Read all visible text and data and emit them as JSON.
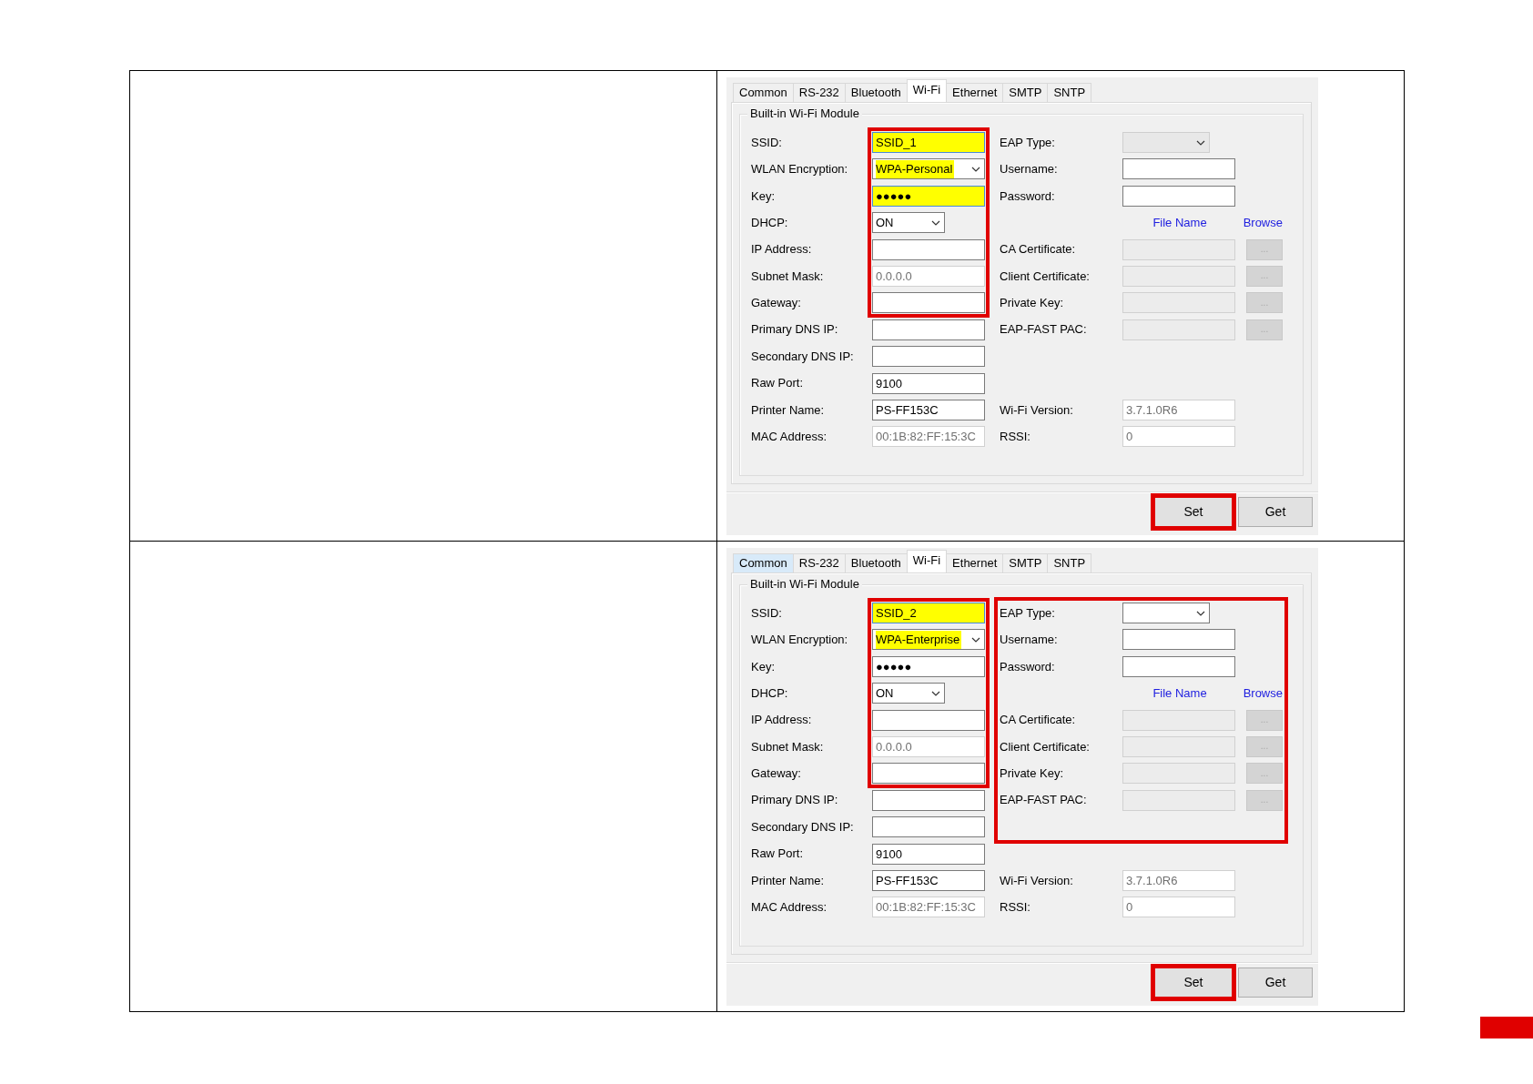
{
  "panels": [
    {
      "tabs": [
        {
          "label": "Common",
          "selected": false,
          "hovered": false
        },
        {
          "label": "RS-232",
          "selected": false,
          "hovered": false
        },
        {
          "label": "Bluetooth",
          "selected": false,
          "hovered": false
        },
        {
          "label": "Wi-Fi",
          "selected": true,
          "hovered": false
        },
        {
          "label": "Ethernet",
          "selected": false,
          "hovered": false
        },
        {
          "label": "SMTP",
          "selected": false,
          "hovered": false
        },
        {
          "label": "SNTP",
          "selected": false,
          "hovered": false
        }
      ],
      "group_title": "Built-in Wi-Fi Module",
      "fields": [
        {
          "label": "SSID:",
          "kind": "text",
          "value": "SSID_1",
          "highlighted": true,
          "disabled": false
        },
        {
          "label": "WLAN Encryption:",
          "kind": "select",
          "value": "WPA-Personal",
          "highlighted": true,
          "disabled": false
        },
        {
          "label": "Key:",
          "kind": "text",
          "value": "●●●●●",
          "highlighted": true,
          "disabled": false
        },
        {
          "label": "DHCP:",
          "kind": "compact",
          "value": "ON",
          "highlighted": false,
          "disabled": false
        },
        {
          "label": "IP Address:",
          "kind": "text",
          "highlighted": false,
          "disabled": false
        },
        {
          "label": "Subnet Mask:",
          "kind": "text",
          "value": "0.0.0.0",
          "highlighted": false,
          "disabled": true
        },
        {
          "label": "Gateway:",
          "kind": "text",
          "highlighted": false,
          "disabled": false
        },
        {
          "label": "Primary DNS IP:",
          "kind": "text",
          "highlighted": false,
          "disabled": false
        },
        {
          "label": "Secondary DNS IP:",
          "kind": "text",
          "highlighted": false,
          "disabled": false
        },
        {
          "label": "Raw Port:",
          "kind": "text",
          "value": "9100",
          "highlighted": false,
          "disabled": false
        },
        {
          "label": "Printer Name:",
          "kind": "text",
          "value": "PS-FF153C",
          "highlighted": false,
          "disabled": false
        },
        {
          "label": "MAC Address:",
          "kind": "text",
          "value": "00:1B:82:FF:15:3C",
          "highlighted": false,
          "disabled": true
        }
      ],
      "right_rows": [
        {
          "kind": "select",
          "label": "EAP Type:",
          "disabled": true
        },
        {
          "kind": "text",
          "label": "Username:",
          "disabled": false
        },
        {
          "kind": "text",
          "label": "Password:",
          "disabled": false
        },
        {
          "kind": "header",
          "file_column": "File Name",
          "browse_column": "Browse"
        },
        {
          "kind": "file",
          "label": "CA Certificate:",
          "button": "...",
          "disabled": true
        },
        {
          "kind": "file",
          "label": "Client Certificate:",
          "button": "...",
          "disabled": true
        },
        {
          "kind": "file",
          "label": "Private Key:",
          "button": "...",
          "disabled": true
        },
        {
          "kind": "file",
          "label": "EAP-FAST PAC:",
          "button": "...",
          "disabled": true
        }
      ],
      "info_rows": [
        {
          "label": "Wi-Fi Version:",
          "value": "3.7.1.0R6",
          "disabled": true
        },
        {
          "label": "RSSI:",
          "value": "0",
          "disabled": true
        }
      ],
      "buttons": [
        {
          "label": "Set",
          "outlined": true
        },
        {
          "label": "Get",
          "outlined": false
        }
      ],
      "network_frame": true,
      "eap_frame": false
    },
    {
      "tabs": [
        {
          "label": "Common",
          "selected": false,
          "hovered": true
        },
        {
          "label": "RS-232",
          "selected": false,
          "hovered": false
        },
        {
          "label": "Bluetooth",
          "selected": false,
          "hovered": false
        },
        {
          "label": "Wi-Fi",
          "selected": true,
          "hovered": false
        },
        {
          "label": "Ethernet",
          "selected": false,
          "hovered": false
        },
        {
          "label": "SMTP",
          "selected": false,
          "hovered": false
        },
        {
          "label": "SNTP",
          "selected": false,
          "hovered": false
        }
      ],
      "group_title": "Built-in Wi-Fi Module",
      "fields": [
        {
          "label": "SSID:",
          "kind": "text",
          "value": "SSID_2",
          "highlighted": true,
          "disabled": false
        },
        {
          "label": "WLAN Encryption:",
          "kind": "select",
          "value": "WPA-Enterprise",
          "highlighted": true,
          "disabled": false
        },
        {
          "label": "Key:",
          "kind": "text",
          "value": "●●●●●",
          "highlighted": false,
          "disabled": false
        },
        {
          "label": "DHCP:",
          "kind": "compact",
          "value": "ON",
          "highlighted": false,
          "disabled": false
        },
        {
          "label": "IP Address:",
          "kind": "text",
          "highlighted": false,
          "disabled": false
        },
        {
          "label": "Subnet Mask:",
          "kind": "text",
          "value": "0.0.0.0",
          "highlighted": false,
          "disabled": true
        },
        {
          "label": "Gateway:",
          "kind": "text",
          "highlighted": false,
          "disabled": false
        },
        {
          "label": "Primary DNS IP:",
          "kind": "text",
          "highlighted": false,
          "disabled": false
        },
        {
          "label": "Secondary DNS IP:",
          "kind": "text",
          "highlighted": false,
          "disabled": false
        },
        {
          "label": "Raw Port:",
          "kind": "text",
          "value": "9100",
          "highlighted": false,
          "disabled": false
        },
        {
          "label": "Printer Name:",
          "kind": "text",
          "value": "PS-FF153C",
          "highlighted": false,
          "disabled": false
        },
        {
          "label": "MAC Address:",
          "kind": "text",
          "value": "00:1B:82:FF:15:3C",
          "highlighted": false,
          "disabled": true
        }
      ],
      "right_rows": [
        {
          "kind": "select",
          "label": "EAP Type:",
          "disabled": false
        },
        {
          "kind": "text",
          "label": "Username:",
          "disabled": false
        },
        {
          "kind": "text",
          "label": "Password:",
          "disabled": false
        },
        {
          "kind": "header",
          "file_column": "File Name",
          "browse_column": "Browse"
        },
        {
          "kind": "file",
          "label": "CA Certificate:",
          "button": "...",
          "disabled": true
        },
        {
          "kind": "file",
          "label": "Client Certificate:",
          "button": "...",
          "disabled": true
        },
        {
          "kind": "file",
          "label": "Private Key:",
          "button": "...",
          "disabled": true
        },
        {
          "kind": "file",
          "label": "EAP-FAST PAC:",
          "button": "...",
          "disabled": true
        }
      ],
      "info_rows": [
        {
          "label": "Wi-Fi Version:",
          "value": "3.7.1.0R6",
          "disabled": true
        },
        {
          "label": "RSSI:",
          "value": "0",
          "disabled": true
        }
      ],
      "buttons": [
        {
          "label": "Set",
          "outlined": true
        },
        {
          "label": "Get",
          "outlined": false
        }
      ],
      "network_frame": true,
      "eap_frame": true
    }
  ]
}
